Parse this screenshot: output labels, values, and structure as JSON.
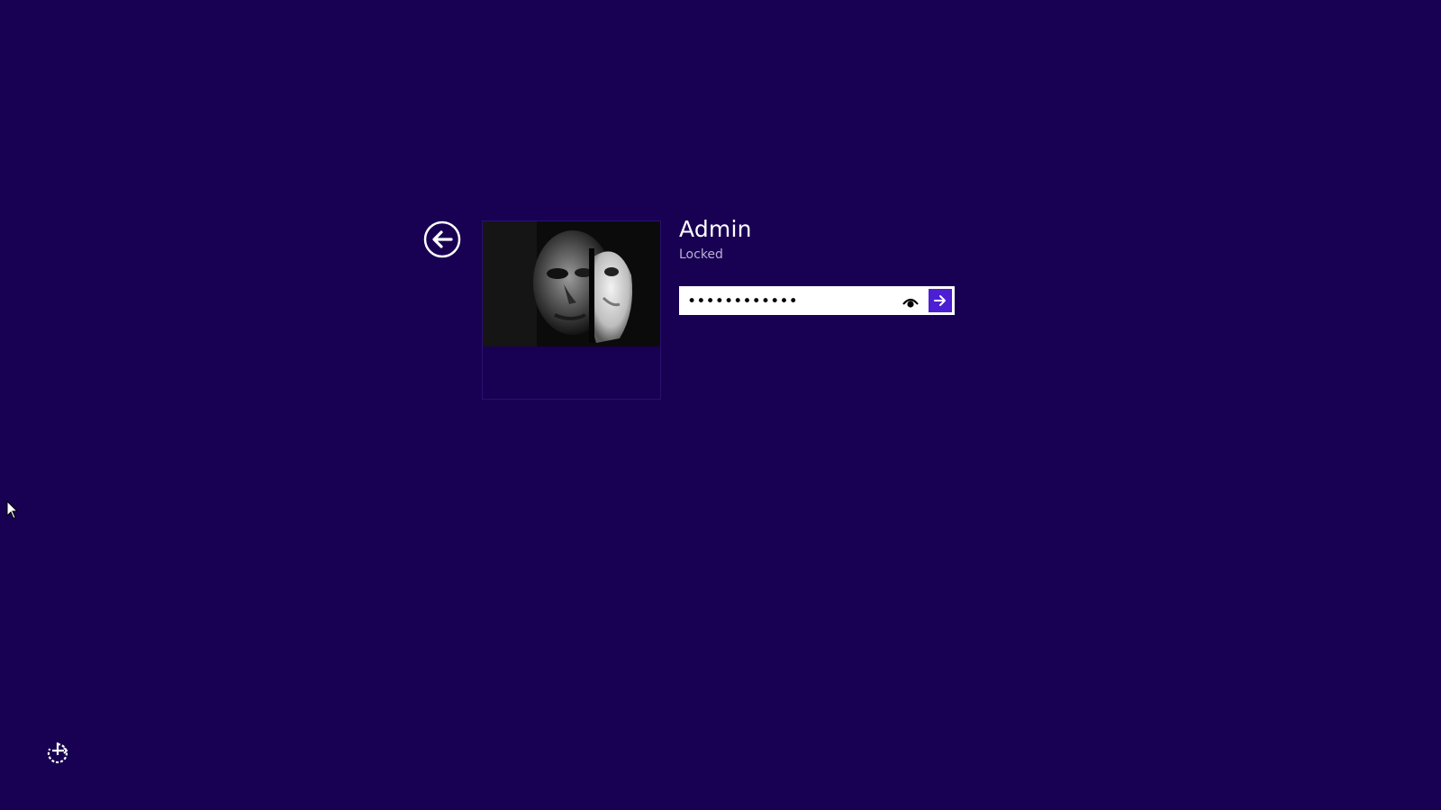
{
  "user": {
    "name": "Admin",
    "status": "Locked"
  },
  "password": {
    "masked_value": "••••••••••••",
    "char_count": 12
  },
  "icons": {
    "back": "back-arrow-icon",
    "reveal": "eye-icon",
    "submit": "arrow-right-icon",
    "ease_of_access": "ease-of-access-icon",
    "cursor": "mouse-pointer-icon"
  },
  "colors": {
    "background": "#180052",
    "submit_accent": "#4c1fd2",
    "status_text": "#b9b2d6"
  }
}
